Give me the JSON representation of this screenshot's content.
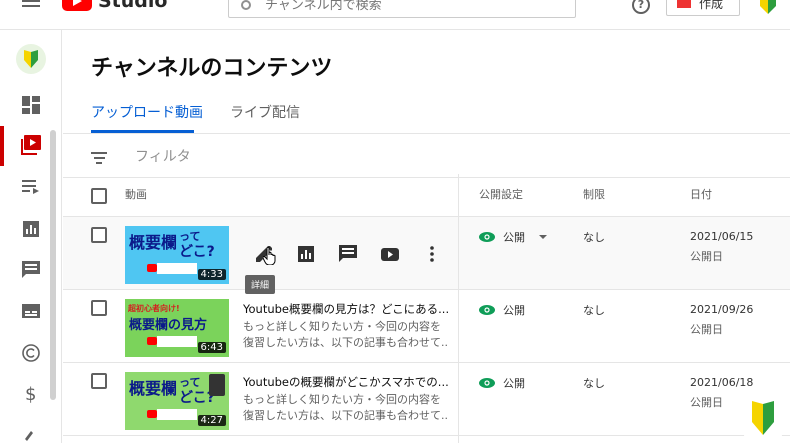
{
  "topbar": {
    "logo_text": "Studio",
    "search_placeholder": "チャンネル内で検索",
    "help_label": "?",
    "create_label": "作成"
  },
  "sidebar": {
    "items": [
      "dashboard-icon",
      "content-icon",
      "playlist-icon",
      "analytics-icon",
      "comments-icon",
      "subtitles-icon",
      "copyright-icon",
      "monetization-icon",
      "customize-icon"
    ],
    "active": "content-icon"
  },
  "main": {
    "title": "チャンネルのコンテンツ",
    "tabs": [
      {
        "label": "アップロード動画",
        "active": true
      },
      {
        "label": "ライブ配信",
        "active": false
      }
    ],
    "filter_label": "フィルタ",
    "headers": {
      "video": "動画",
      "visibility": "公開設定",
      "restrictions": "制限",
      "date": "日付"
    },
    "tooltip": "詳細",
    "rows": [
      {
        "thumb_line1": "概要欄",
        "thumb_line2": "って",
        "thumb_line3": "どこ?",
        "duration": "4:33",
        "title": "",
        "desc": [],
        "visibility": "公開",
        "restriction": "なし",
        "date": "2021/06/15",
        "date_status": "公開日"
      },
      {
        "thumb_top": "超初心者向け!",
        "thumb_line1": "概要欄の見方",
        "duration": "6:43",
        "title": "Youtube概要欄の見方は？どこにある...",
        "desc": [
          "もっと詳しく知りたい方・今回の内容を",
          "復習したい方は、以下の記事も合わせて..."
        ],
        "visibility": "公開",
        "restriction": "なし",
        "date": "2021/09/26",
        "date_status": "公開日"
      },
      {
        "thumb_line1": "概要欄",
        "thumb_line2": "って",
        "thumb_line3": "どこ?",
        "duration": "4:27",
        "title": "Youtubeの概要欄がどこかスマホでの...",
        "desc": [
          "もっと詳しく知りたい方・今回の内容を",
          "復習したい方は、以下の記事も合わせて..."
        ],
        "visibility": "公開",
        "restriction": "なし",
        "date": "2021/06/18",
        "date_status": "公開日"
      }
    ]
  },
  "colors": {
    "accent": "#065fd4",
    "brand_red": "#ff0000",
    "public_green": "#0f9d58"
  }
}
